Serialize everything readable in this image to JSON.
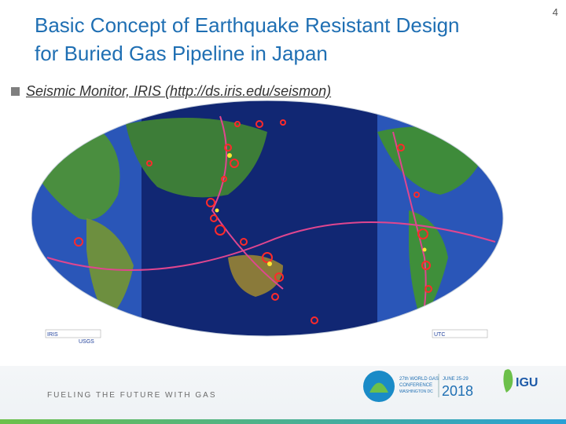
{
  "slide": {
    "title_line1": "Basic Concept of Earthquake Resistant Design",
    "title_line2": "for Buried Gas Pipeline in Japan",
    "page_number": "4",
    "bullet": "Seismic Monitor, IRIS (http://ds.iris.edu/seismon)"
  },
  "map": {
    "iris_label": "IRIS",
    "usgs_label": "USGS",
    "utc_label": "UTC"
  },
  "footer": {
    "tagline": "FUELING THE FUTURE WITH GAS",
    "conf_line1": "27th WORLD GAS",
    "conf_line2": "CONFERENCE",
    "conf_city": "WASHINGTON DC",
    "conf_dates": "JUNE 25-29",
    "conf_year": "2018",
    "igu": "IGU"
  },
  "colors": {
    "title": "#1f6fb3",
    "ocean": "#1f3f9a",
    "land": "#3f8f3a",
    "quake": "#ff2a2a"
  }
}
